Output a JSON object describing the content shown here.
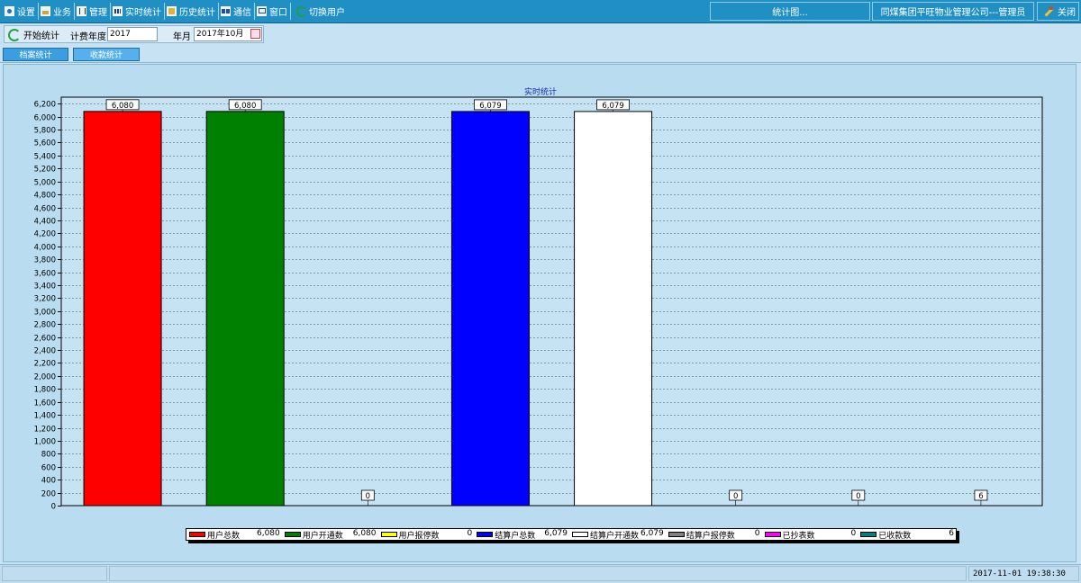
{
  "menu": {
    "items": [
      {
        "label": "设置",
        "icon": "settings-icon"
      },
      {
        "label": "业务",
        "icon": "business-icon"
      },
      {
        "label": "管理",
        "icon": "admin-icon"
      },
      {
        "label": "实时统计",
        "icon": "realtime-stats-icon"
      },
      {
        "label": "历史统计",
        "icon": "history-stats-icon"
      },
      {
        "label": "通信",
        "icon": "communication-icon"
      },
      {
        "label": "窗口",
        "icon": "window-icon"
      },
      {
        "label": "切换用户",
        "icon": "switch-user-icon"
      }
    ],
    "status_title": "统计图...",
    "company_user": "同煤集团平旺物业管理公司---管理员",
    "close_label": "关闭"
  },
  "toolbar": {
    "start_label": "开始统计",
    "billing_year_label": "计费年度",
    "billing_year_value": "2017",
    "month_label": "年月",
    "month_value": "2017年10月"
  },
  "tabs": [
    {
      "label": "档案统计",
      "active": false
    },
    {
      "label": "收款统计",
      "active": true
    }
  ],
  "colors": {
    "frame": "#1f8fc4",
    "panel": "#b9dcf0",
    "series": [
      "#ff0000",
      "#008000",
      "#ffff00",
      "#0000ff",
      "#ffffff",
      "#808080",
      "#ff00ff",
      "#008080"
    ]
  },
  "chart_data": {
    "type": "bar",
    "title": "实时统计",
    "categories": [
      "用户总数",
      "用户开通数",
      "用户报停数",
      "结算户总数",
      "结算户开通数",
      "结算户报停数",
      "已抄表数",
      "已收款数"
    ],
    "values": [
      6080,
      6080,
      0,
      6079,
      6079,
      0,
      0,
      6
    ],
    "value_labels": [
      "6,080",
      "6,080",
      "0",
      "6,079",
      "6,079",
      "0",
      "0",
      "6"
    ],
    "yticks": [
      "0",
      "200",
      "400",
      "600",
      "800",
      "1,000",
      "1,200",
      "1,400",
      "1,600",
      "1,800",
      "2,000",
      "2,200",
      "2,400",
      "2,600",
      "2,800",
      "3,000",
      "3,200",
      "3,400",
      "3,600",
      "3,800",
      "4,000",
      "4,200",
      "4,400",
      "4,600",
      "4,800",
      "5,000",
      "5,200",
      "5,400",
      "5,600",
      "5,800",
      "6,000",
      "6,200"
    ],
    "ylim": [
      0,
      6300
    ],
    "grid": true,
    "legend_position": "bottom"
  },
  "status": {
    "datetime": "2017-11-01 19:38:30"
  }
}
